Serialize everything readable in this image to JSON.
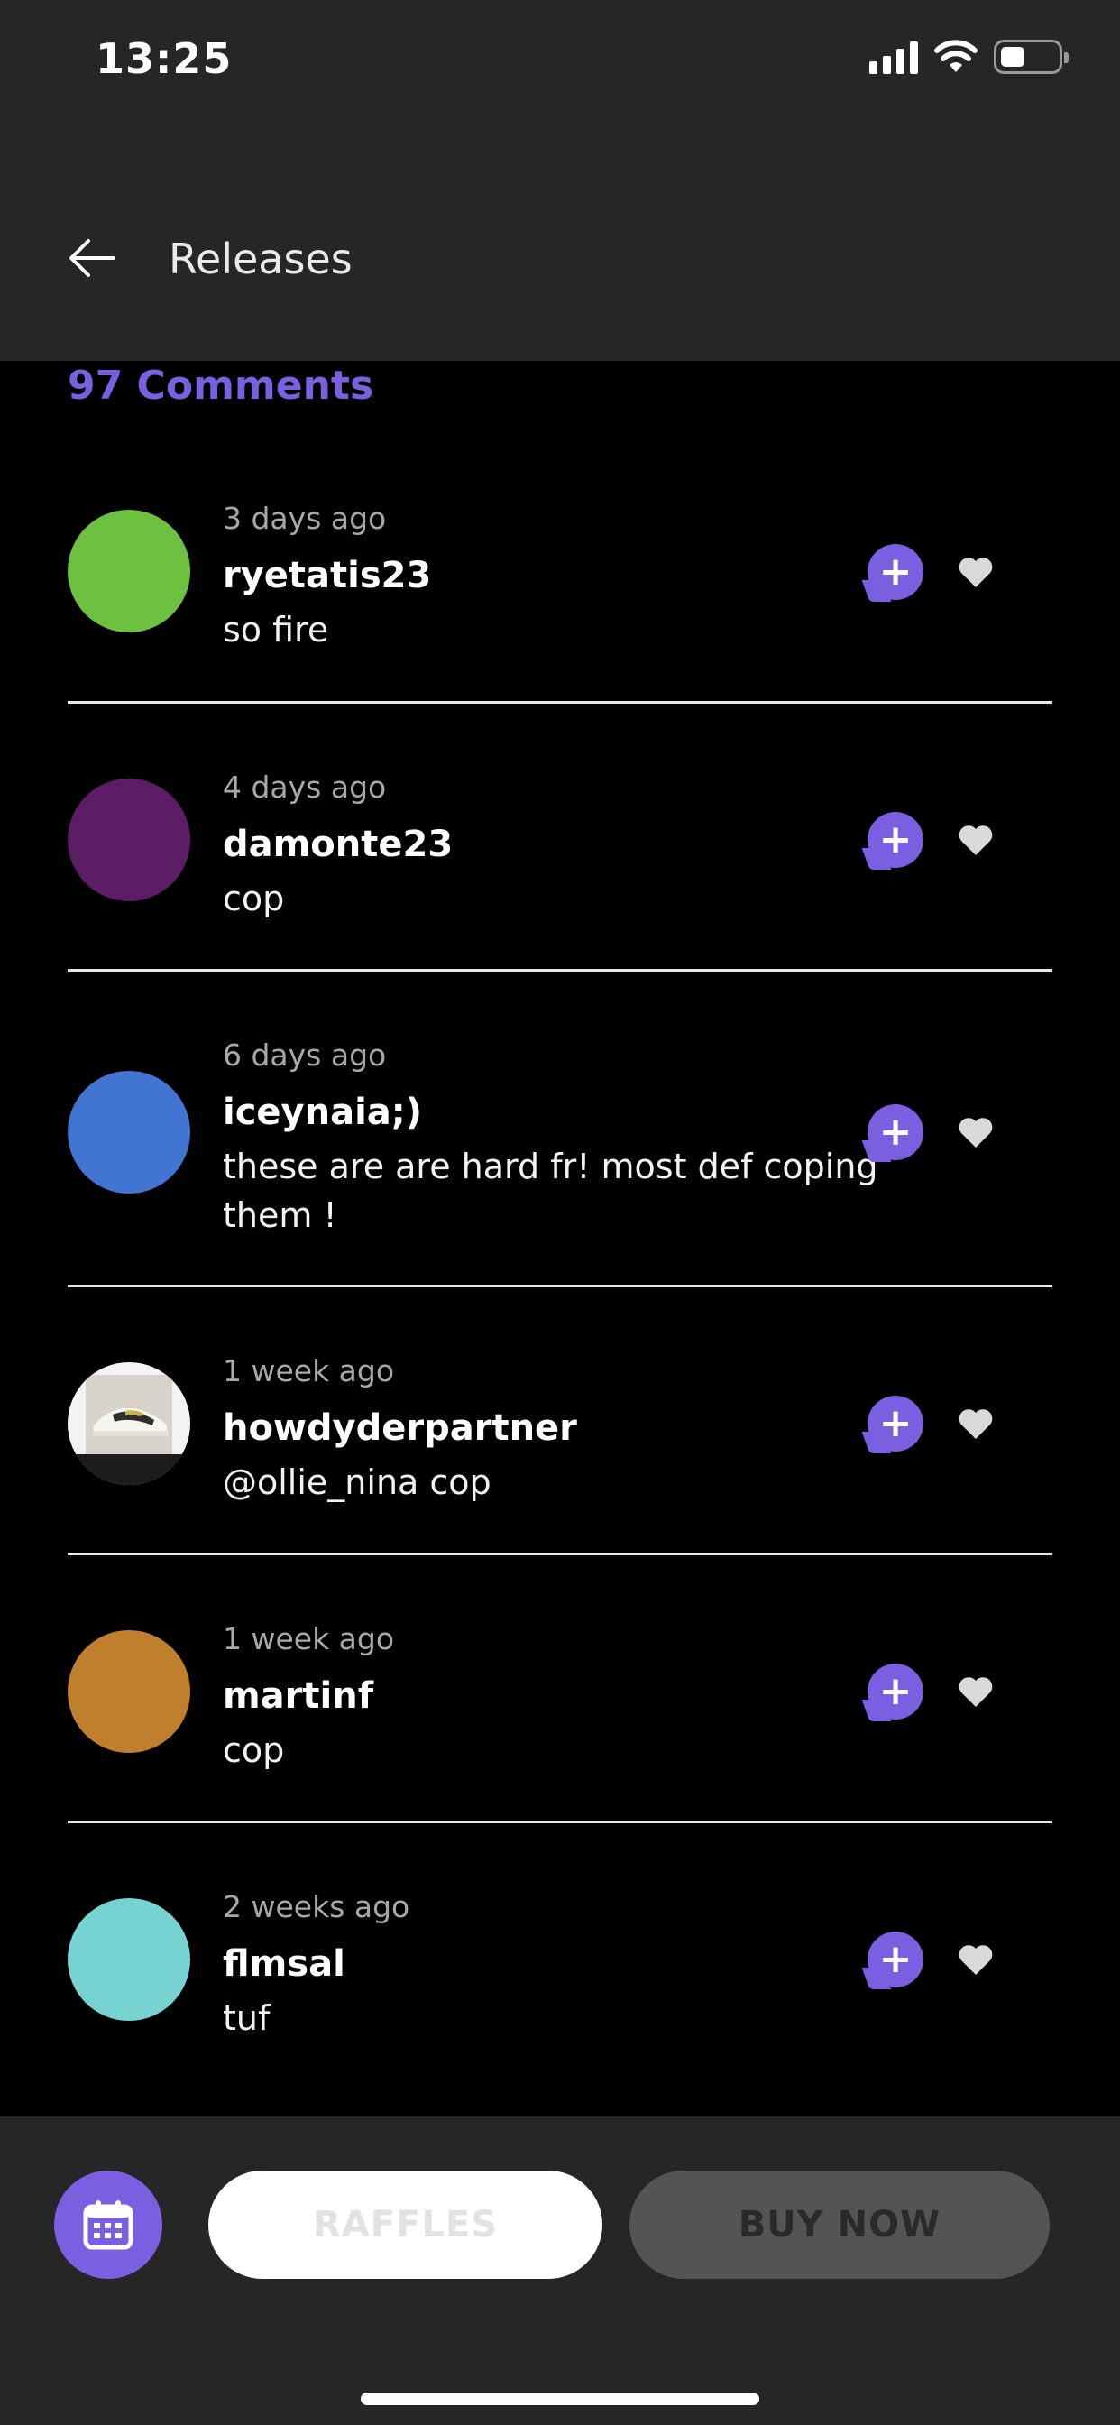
{
  "status_bar": {
    "time": "13:25"
  },
  "header": {
    "title": "Releases"
  },
  "comments_count_label": "97 Comments",
  "colors": {
    "accent": "#7a5fe0",
    "header_bg": "#262626",
    "background": "#000000"
  },
  "comments": [
    {
      "time": "3 days ago",
      "user": "ryetatis23",
      "text": "so fire",
      "avatar_color": "#6ec140"
    },
    {
      "time": "4 days ago",
      "user": "damonte23",
      "text": "cop",
      "avatar_color": "#5c1c66"
    },
    {
      "time": "6 days ago",
      "user": "iceynaia;)",
      "text": "these are are hard fr! most def coping them !",
      "avatar_color": "#4274d2"
    },
    {
      "time": "1 week ago",
      "user": "howdyderpartner",
      "text": "@ollie_nina cop",
      "avatar_color": "image"
    },
    {
      "time": "1 week ago",
      "user": "martinf",
      "text": "cop",
      "avatar_color": "#c07f2c"
    },
    {
      "time": "2 weeks ago",
      "user": "flmsal",
      "text": "tuf",
      "avatar_color": "#76d3d1"
    }
  ],
  "bottom_bar": {
    "raffles_label": "RAFFLES",
    "buy_now_label": "BUY NOW"
  },
  "icons": [
    "back-arrow-icon",
    "reply-plus-icon",
    "heart-icon",
    "calendar-icon",
    "signal-icon",
    "wifi-icon",
    "battery-icon"
  ]
}
